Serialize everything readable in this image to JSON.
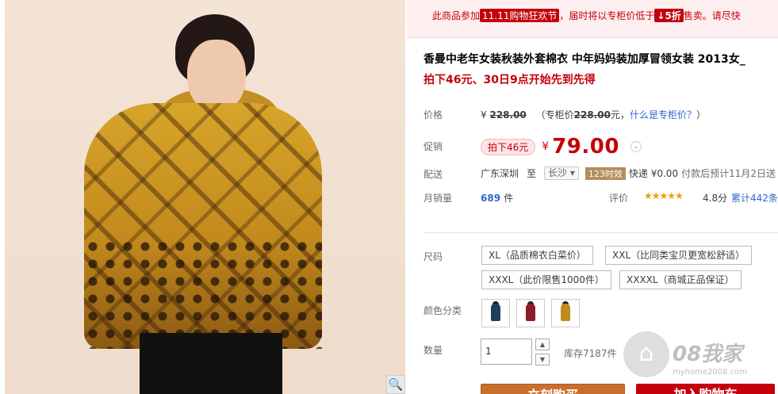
{
  "promo_banner": {
    "text_1": "此商品参加",
    "tag": "11.11购物狂欢节",
    "text_2": "，届时将以专柜价低于",
    "discount": "↓5折",
    "text_3": "售卖。请尽快"
  },
  "product": {
    "title": "香曼中老年女装秋装外套棉衣 中年妈妈装加厚冒领女装 2013女_",
    "subtitle": "拍下46元、30日9点开始先到先得"
  },
  "price": {
    "label": "价格",
    "currency": "¥",
    "original": "228.00",
    "counter_prefix": "（专柜价",
    "counter_value": "228.00",
    "counter_suffix": "元，",
    "what_link": "什么是专柜价？",
    "close_paren": "）"
  },
  "promotion": {
    "label": "促销",
    "badge": "拍下46元",
    "currency": "¥",
    "price": "79.00"
  },
  "shipping": {
    "label": "配送",
    "from": "广东深圳",
    "to_word": "至",
    "to_city": "长沙",
    "days_badge": "123时效",
    "express": "快递 ¥0.00",
    "eta": "付款后预计11月2日送"
  },
  "sales": {
    "label": "月销量",
    "count": "689",
    "unit": "件",
    "rating_label": "评价",
    "stars": "★★★★★",
    "score": "4.8分",
    "reviews": "累计442条"
  },
  "size": {
    "label": "尺码",
    "options": [
      "XL（品质棉衣白菜价）",
      "XXL（比同类宝贝更宽松舒适）",
      "XXXL（此价限售1000件）",
      "XXXXL（商城正品保证）"
    ]
  },
  "color": {
    "label": "颜色分类",
    "swatch_colors": [
      "#1f3f5c",
      "#8a1d2a",
      "#c08b1e"
    ]
  },
  "quantity": {
    "label": "数量",
    "value": "1",
    "up": "▲",
    "down": "▼",
    "stock": "库存7187件"
  },
  "actions": {
    "buy": "立刻购买",
    "cart": "加入购物车"
  },
  "watermark": {
    "brand": "08我家",
    "url": "myhome2008.com"
  },
  "icons": {
    "zoom": "🔍",
    "house": "⌂",
    "chevron": "⌄",
    "dropdown": "▾"
  }
}
